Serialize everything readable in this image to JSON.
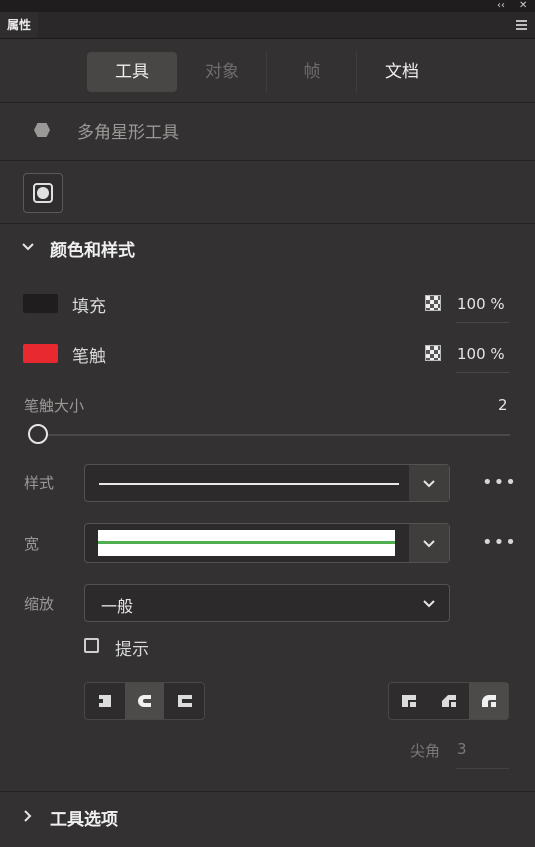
{
  "window": {
    "collapse_glyph": "‹‹",
    "close_glyph": "✕",
    "panel_title": "属性",
    "menu_icon": "hamburger-icon"
  },
  "tabs": [
    {
      "label": "工具",
      "state": "active"
    },
    {
      "label": "对象",
      "state": "disabled"
    },
    {
      "label": "帧",
      "state": "disabled"
    },
    {
      "label": "文档",
      "state": "normal"
    }
  ],
  "tool": {
    "icon": "hexagon-icon",
    "name": "多角星形工具"
  },
  "tool_option_button_icon": "polygon-settings-icon",
  "color_style": {
    "title": "颜色和样式",
    "expanded": true,
    "fill": {
      "label": "填充",
      "color": "#1f1d1d",
      "alpha": "100 %"
    },
    "stroke": {
      "label": "笔触",
      "color": "#e8292f",
      "alpha": "100 %"
    },
    "stroke_size": {
      "label": "笔触大小",
      "value": "2"
    },
    "style": {
      "label": "样式"
    },
    "width": {
      "label": "宽"
    },
    "scale": {
      "label": "缩放",
      "value": "一般"
    },
    "hint": {
      "label": "提示",
      "checked": false
    },
    "cap_buttons": [
      "cap-none-icon",
      "cap-round-icon",
      "cap-square-icon"
    ],
    "cap_active": 1,
    "join_buttons": [
      "join-miter-icon",
      "join-bevel-icon",
      "join-round-icon"
    ],
    "join_active": 2,
    "miter": {
      "label": "尖角",
      "value": "3"
    },
    "more_glyph": "•••"
  },
  "tool_options": {
    "title": "工具选项",
    "expanded": false
  }
}
